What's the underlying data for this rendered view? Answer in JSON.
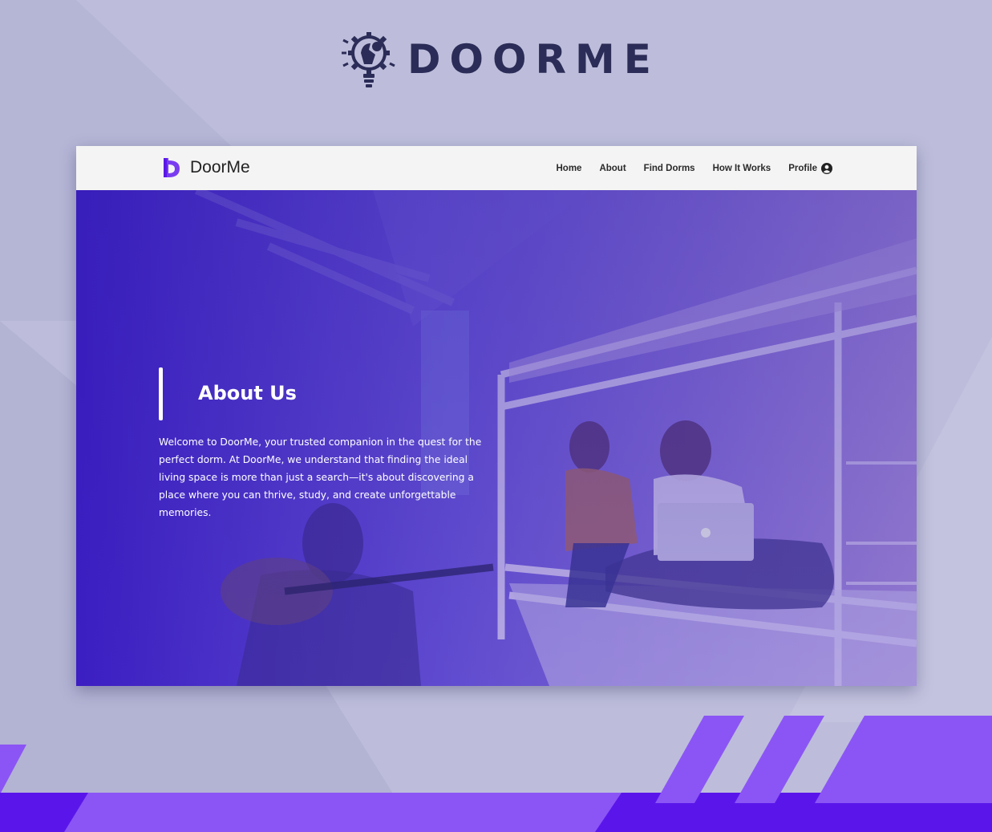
{
  "brand": {
    "name": "DOORME"
  },
  "navbar": {
    "logo_text": "DoorMe",
    "links": [
      {
        "label": "Home"
      },
      {
        "label": "About"
      },
      {
        "label": "Find Dorms"
      },
      {
        "label": "How It Works"
      },
      {
        "label": "Profile"
      }
    ]
  },
  "hero": {
    "title": "About Us",
    "body": "Welcome to DoorMe, your trusted companion in the quest for the perfect dorm. At DoorMe, we understand that finding the ideal living space is more than just a search—it's about discovering a place where you can thrive, study, and create unforgettable memories."
  },
  "colors": {
    "accent": "#7a3cf0",
    "accent_dark": "#5a18e8",
    "brand_text": "#2b2c57",
    "background": "#bdbddb"
  },
  "icons": [
    "gear-bulb-icon",
    "door-logo-icon",
    "user-circle-icon"
  ]
}
